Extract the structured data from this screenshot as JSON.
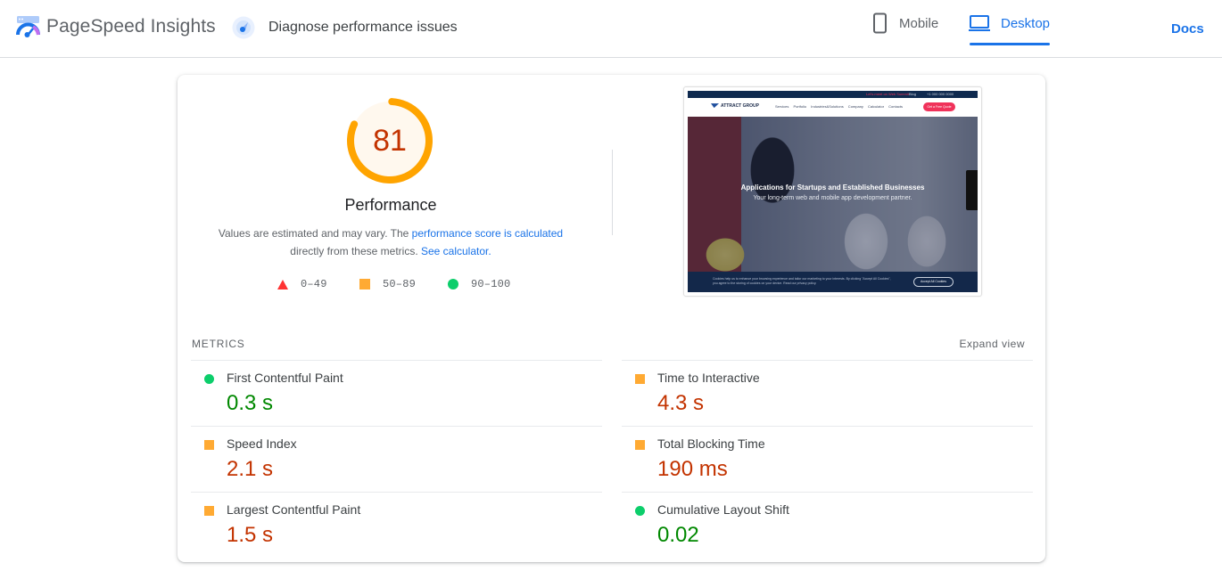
{
  "header": {
    "app_name": "PageSpeed Insights",
    "subtitle": "Diagnose performance issues",
    "tabs": [
      {
        "label": "Mobile",
        "icon": "smartphone-icon",
        "active": false
      },
      {
        "label": "Desktop",
        "icon": "laptop-icon",
        "active": true
      }
    ],
    "docs_label": "Docs"
  },
  "score": {
    "value": "81",
    "fraction": 0.81,
    "category": "Performance",
    "desc_prefix": "Values are estimated and may vary. The ",
    "desc_link1": "performance score is calculated",
    "desc_mid": " directly from these metrics. ",
    "desc_link2": "See calculator.",
    "legend": [
      {
        "shape": "triangle",
        "range": "0–49"
      },
      {
        "shape": "square",
        "range": "50–89"
      },
      {
        "shape": "circle",
        "range": "90–100"
      }
    ]
  },
  "screenshot": {
    "topbar_left": "Let's meet on Web Summit",
    "topbar_blog": "Blog",
    "topbar_phone": "+1 000 000 0000",
    "logo": "ATTRACT GROUP",
    "nav": "Services Portfolio Industries&Solutions Company Calculator Contacts",
    "cta": "Get a Free Quote",
    "headline": "Applications for Startups and Established Businesses",
    "subheadline": "Your long-term web and mobile app development partner.",
    "cookie_text": "Cookies help us to enhance your browsing experience and tailor our marketing to your interests. By clicking \"Accept All Cookies\", you agree to the storing of cookies on your device. Read our privacy policy.",
    "cookie_button": "Accept All Cookies"
  },
  "metrics": {
    "section_label": "METRICS",
    "expand_label": "Expand view",
    "left": [
      {
        "name": "First Contentful Paint",
        "value": "0.3 s",
        "rating": "pass"
      },
      {
        "name": "Speed Index",
        "value": "2.1 s",
        "rating": "average"
      },
      {
        "name": "Largest Contentful Paint",
        "value": "1.5 s",
        "rating": "average"
      }
    ],
    "right": [
      {
        "name": "Time to Interactive",
        "value": "4.3 s",
        "rating": "average"
      },
      {
        "name": "Total Blocking Time",
        "value": "190 ms",
        "rating": "average"
      },
      {
        "name": "Cumulative Layout Shift",
        "value": "0.02",
        "rating": "pass"
      }
    ]
  },
  "colors": {
    "accent": "#1a73e8",
    "fail": "#ff3333",
    "average": "#ffaa33",
    "average_text": "#c33300",
    "pass": "#0cce6b",
    "pass_text": "#008800",
    "gauge_bg": "#fff8ee"
  }
}
